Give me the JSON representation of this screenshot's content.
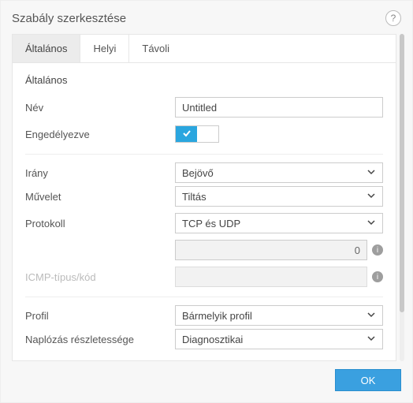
{
  "header": {
    "title": "Szabály szerkesztése"
  },
  "tabs": [
    {
      "label": "Általános",
      "active": true
    },
    {
      "label": "Helyi",
      "active": false
    },
    {
      "label": "Távoli",
      "active": false
    }
  ],
  "section_heading": "Általános",
  "fields": {
    "name_label": "Név",
    "name_value": "Untitled",
    "enabled_label": "Engedélyezve",
    "enabled_value": true,
    "direction_label": "Irány",
    "direction_value": "Bejövő",
    "action_label": "Művelet",
    "action_value": "Tiltás",
    "protocol_label": "Protokoll",
    "protocol_value": "TCP és UDP",
    "port_value": "0",
    "icmp_label": "ICMP-típus/kód",
    "profile_label": "Profil",
    "profile_value": "Bármelyik profil",
    "logging_label": "Naplózás részletessége",
    "logging_value": "Diagnosztikai"
  },
  "footer": {
    "ok_label": "OK"
  }
}
